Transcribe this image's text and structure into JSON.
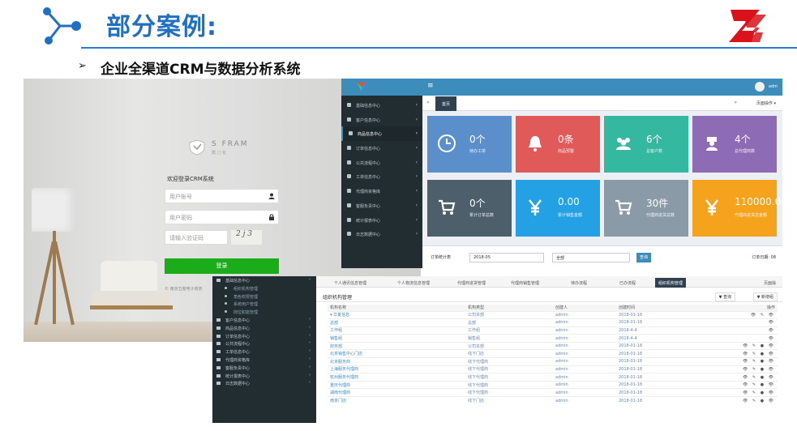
{
  "slide": {
    "title": "部分案例:",
    "bullet": "➢",
    "subtitle": "企业全渠道CRM与数据分析系统",
    "colors": {
      "title": "#1f6fc4",
      "rule": "#2a7bd0",
      "logo": "#d9121b"
    }
  },
  "login": {
    "brand": "S  FRAM",
    "brand_sub": "数  □  化",
    "welcome": "欢迎登录CRM系统",
    "username_placeholder": "用户账号",
    "password_placeholder": "用户密码",
    "captcha_placeholder": "请输入验证码",
    "captcha_text": "2 j 3",
    "login_button": "登录",
    "company": "© 南京五窗电子商务"
  },
  "dashboard": {
    "sidebar_items": [
      {
        "label": "基础信息中心",
        "active": false
      },
      {
        "label": "客户信息中心",
        "active": false
      },
      {
        "label": "商品信息中心",
        "active": true
      },
      {
        "label": "订单信息中心",
        "active": false
      },
      {
        "label": "公共流程中心",
        "active": false
      },
      {
        "label": "工单信息中心",
        "active": false
      },
      {
        "label": "代理商资格库",
        "active": false
      },
      {
        "label": "客服负责中心",
        "active": false
      },
      {
        "label": "统计报表中心",
        "active": false
      },
      {
        "label": "日志数据中心",
        "active": false
      }
    ],
    "tab_home": "首页",
    "page_ops": "页面操作 ▾",
    "tiles": [
      {
        "value": "0个",
        "label": "待办工单",
        "color": "#5b8fcc",
        "icon": "clock-icon"
      },
      {
        "value": "0条",
        "label": "商品预警",
        "color": "#e05a5a",
        "icon": "bell-icon"
      },
      {
        "value": "6个",
        "label": "总客户数",
        "color": "#35b8a0",
        "icon": "users-icon"
      },
      {
        "value": "4个",
        "label": "总代理商数",
        "color": "#8e6bb5",
        "icon": "agent-icon"
      },
      {
        "value": "0个",
        "label": "累计订单总数",
        "color": "#4c5f6a",
        "icon": "cart-icon"
      },
      {
        "value": "0.00",
        "label": "累计销售金额",
        "color": "#24a0e5",
        "icon": "yen-icon"
      },
      {
        "value": "30件",
        "label": "代理商进货总数",
        "color": "#8a9aa6",
        "icon": "cart-icon"
      },
      {
        "value": "110000.00",
        "label": "代理商进货总金额",
        "color": "#f5a21c",
        "icon": "yen-icon"
      }
    ],
    "filter": {
      "label": "订单统计表",
      "date": "2018-05",
      "select": "全部",
      "button": "查询",
      "right": "订单日期: 08"
    },
    "colors": {
      "topbar": "#3c8dbc",
      "sidebar": "#222d32",
      "content": "#ecf0f5"
    }
  },
  "org": {
    "sidebar_items": [
      {
        "label": "基础信息中心",
        "sub": false
      },
      {
        "label": "组织机构管理",
        "sub": true
      },
      {
        "label": "角色权限管理",
        "sub": true
      },
      {
        "label": "系统用户管理",
        "sub": true
      },
      {
        "label": "岗位职能管理",
        "sub": true
      },
      {
        "label": "客户信息中心",
        "sub": false
      },
      {
        "label": "商品信息中心",
        "sub": false
      },
      {
        "label": "订单信息中心",
        "sub": false
      },
      {
        "label": "公共流程中心",
        "sub": false
      },
      {
        "label": "工单信息中心",
        "sub": false
      },
      {
        "label": "代理商资格库",
        "sub": false
      },
      {
        "label": "客服负责中心",
        "sub": false
      },
      {
        "label": "统计报表中心",
        "sub": false
      },
      {
        "label": "日志数据中心",
        "sub": false
      }
    ],
    "tabs": [
      {
        "label": "个人通讯信息管理",
        "active": false
      },
      {
        "label": "个人物流信息管理",
        "active": false
      },
      {
        "label": "代理商进货管理",
        "active": false
      },
      {
        "label": "代理商销售管理",
        "active": false
      },
      {
        "label": "待办流程",
        "active": false
      },
      {
        "label": "已办流程",
        "active": false
      },
      {
        "label": "组织机构管理",
        "active": true
      }
    ],
    "page_ops": "页面操",
    "title": "组织机构管理",
    "btn_search": "▼ 查询",
    "btn_add": "▼ 新增组",
    "headers": [
      "机构名称",
      "机构类型",
      "创建人",
      "创建时间",
      "操作"
    ],
    "rows": [
      [
        "▾ 华夏信息",
        "公司本部",
        "admin",
        "2018-01-18",
        "👁 ✎ 👁"
      ],
      [
        "  总部",
        "总部",
        "admin",
        "2018-01-18",
        "👁"
      ],
      [
        "  工作组",
        "工作组",
        "admin",
        "2018-4-4",
        "👁"
      ],
      [
        "  销售组",
        "销售组",
        "admin",
        "2018-4-4",
        "👁"
      ],
      [
        "  财务部",
        "公司本部",
        "admin",
        "2018-01-18",
        "👁 ✎ ● 👁"
      ],
      [
        "  北京销售中心门店",
        "线下门店",
        "admin",
        "2018-01-18",
        "👁 ✎ ● 👁"
      ],
      [
        "  北京服务商",
        "线下代理商",
        "admin",
        "2018-01-18",
        "👁 ✎ ● 👁"
      ],
      [
        "  上海服务代理商",
        "线下代理商",
        "admin",
        "2018-01-18",
        "👁 ✎ ● 👁"
      ],
      [
        "  杭州服务代理商",
        "线下代理商",
        "admin",
        "2018-01-18",
        "👁 ✎ ● 👁"
      ],
      [
        "  重庆代理商",
        "线下代理商",
        "admin",
        "2018-01-18",
        "👁 ✎ ● 👁"
      ],
      [
        "  湖南代理商",
        "线下代理商",
        "admin",
        "2018-01-18",
        "👁 ✎ ● 👁"
      ],
      [
        "  南京门店",
        "线下门店",
        "admin",
        "2018-01-18",
        "👁 ✎ ● 👁"
      ]
    ]
  }
}
